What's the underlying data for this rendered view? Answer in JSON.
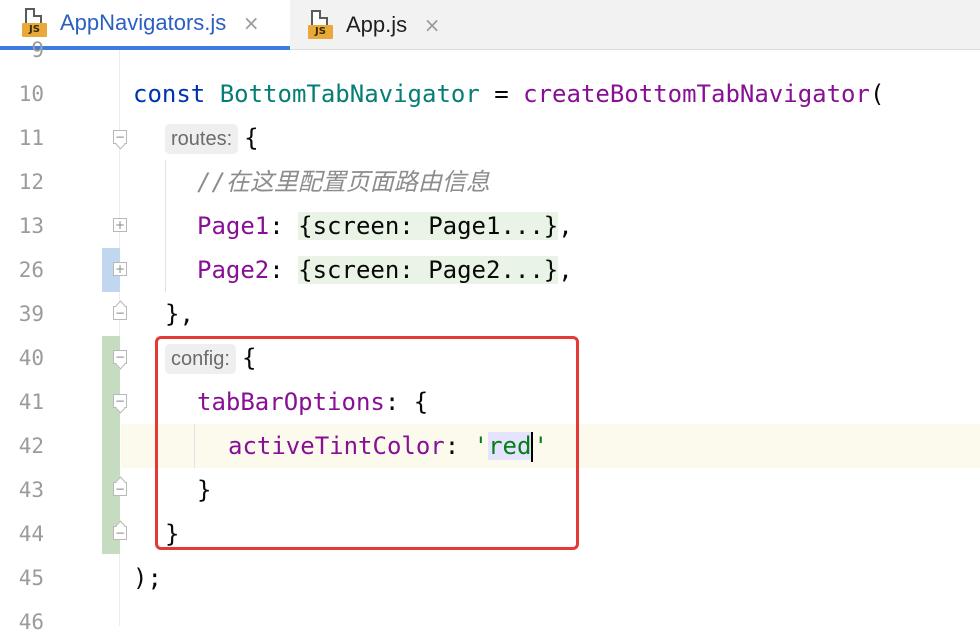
{
  "tabs": [
    {
      "label": "AppNavigators.js",
      "badge": "JS",
      "icon": "js-file-icon",
      "active": true
    },
    {
      "label": "App.js",
      "badge": "JS",
      "icon": "js-file-icon",
      "active": false
    }
  ],
  "close_glyph": "×",
  "line_numbers": [
    "9",
    "10",
    "11",
    "12",
    "13",
    "26",
    "39",
    "40",
    "41",
    "42",
    "43",
    "44",
    "45",
    "46"
  ],
  "code": {
    "l10": {
      "kw": "const",
      "cls": "BottomTabNavigator",
      "eq": " = ",
      "fn": "createBottomTabNavigator",
      "paren": "("
    },
    "l11": {
      "hint": "routes:",
      "brace": "{"
    },
    "l12": {
      "comment": "//在这里配置页面路由信息"
    },
    "l13": {
      "key": "Page1",
      "colon": ": ",
      "folded": "{screen: Page1...}",
      "comma": ","
    },
    "l26": {
      "key": "Page2",
      "colon": ": ",
      "folded": "{screen: Page2...}",
      "comma": ","
    },
    "l39": {
      "text": "},"
    },
    "l40": {
      "hint": "config:",
      "brace": "{"
    },
    "l41": {
      "key": "tabBarOptions",
      "rest": ": {"
    },
    "l42": {
      "key": "activeTintColor",
      "colon": ": ",
      "q1": "'",
      "value": "red",
      "q2": "'"
    },
    "l43": {
      "text": "}"
    },
    "l44": {
      "text": "}"
    },
    "l45": {
      "text": ");"
    }
  },
  "colors": {
    "annotation": "#e53935",
    "accent": "#3d7be0"
  }
}
